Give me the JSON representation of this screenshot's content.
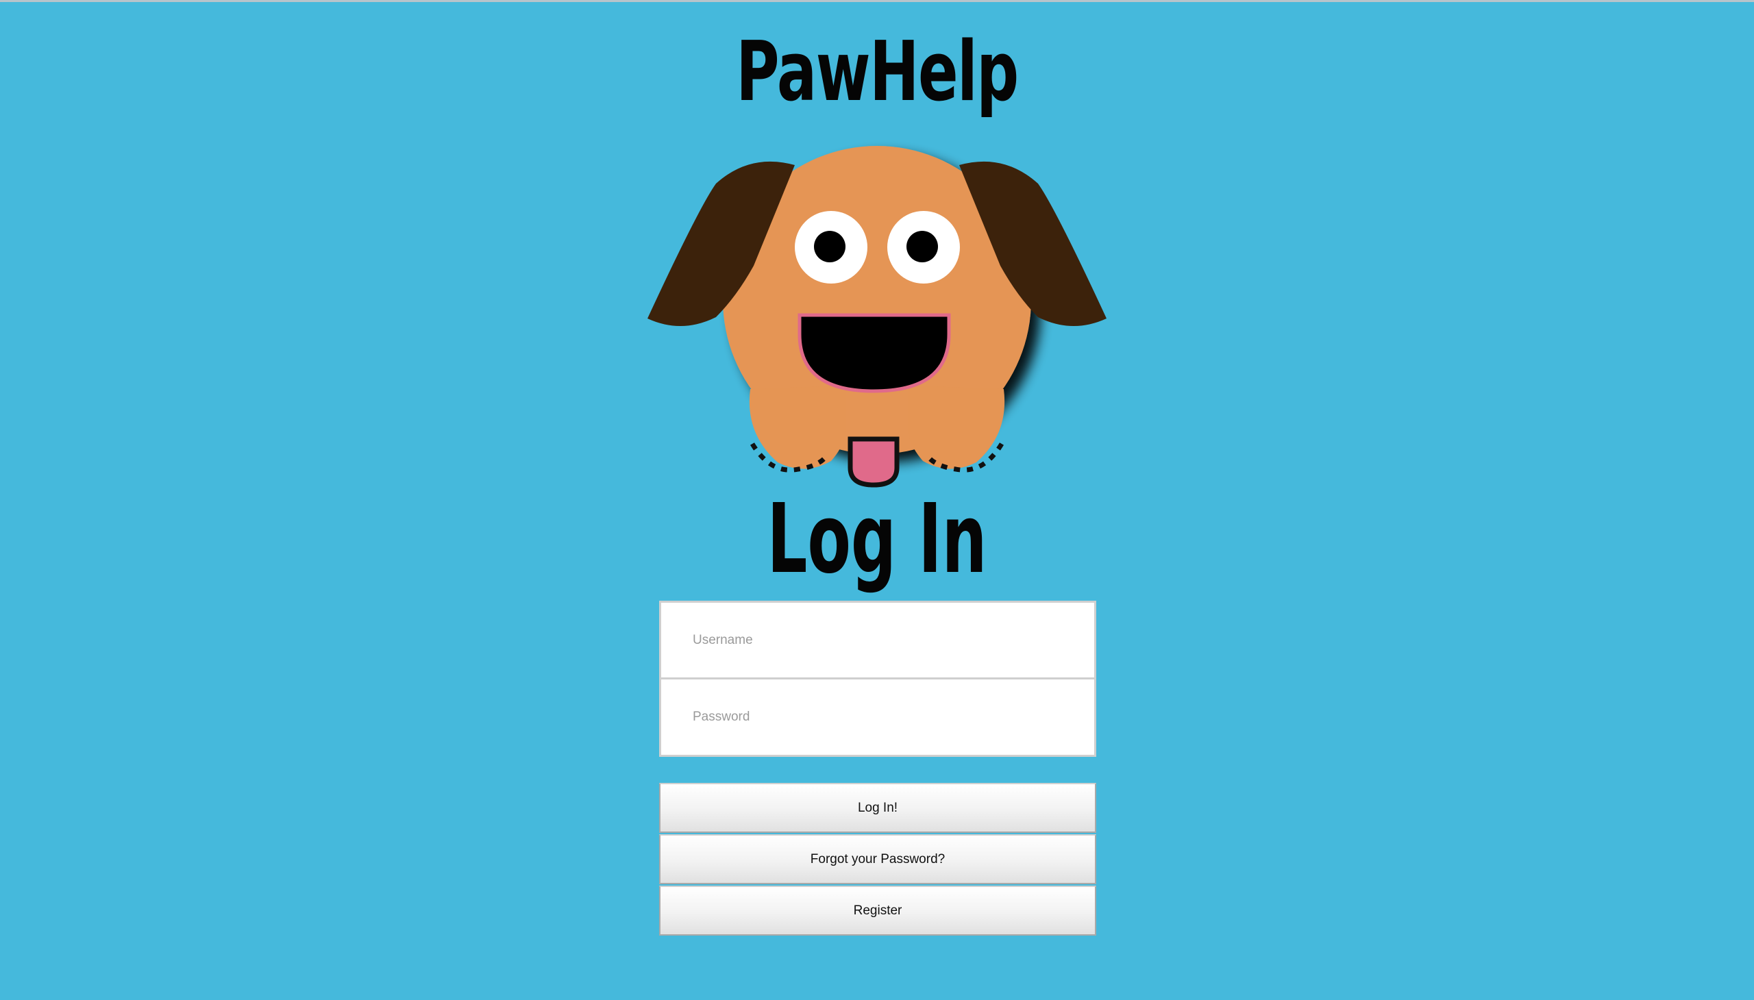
{
  "header": {
    "app_title": "PawHelp"
  },
  "mascot": {
    "icon": "dog-mascot-icon",
    "colors": {
      "face": "#e59554",
      "ears": "#3c220b",
      "tongue": "#e06a8a",
      "mouth_outline": "#e06a8a"
    }
  },
  "main": {
    "heading": "Log In"
  },
  "login_form": {
    "username": {
      "placeholder": "Username",
      "value": ""
    },
    "password": {
      "placeholder": "Password",
      "value": ""
    },
    "login_button": "Log In!",
    "forgot_password_button": "Forgot your Password?",
    "register_button": "Register"
  },
  "theme": {
    "background": "#45b9dc"
  }
}
